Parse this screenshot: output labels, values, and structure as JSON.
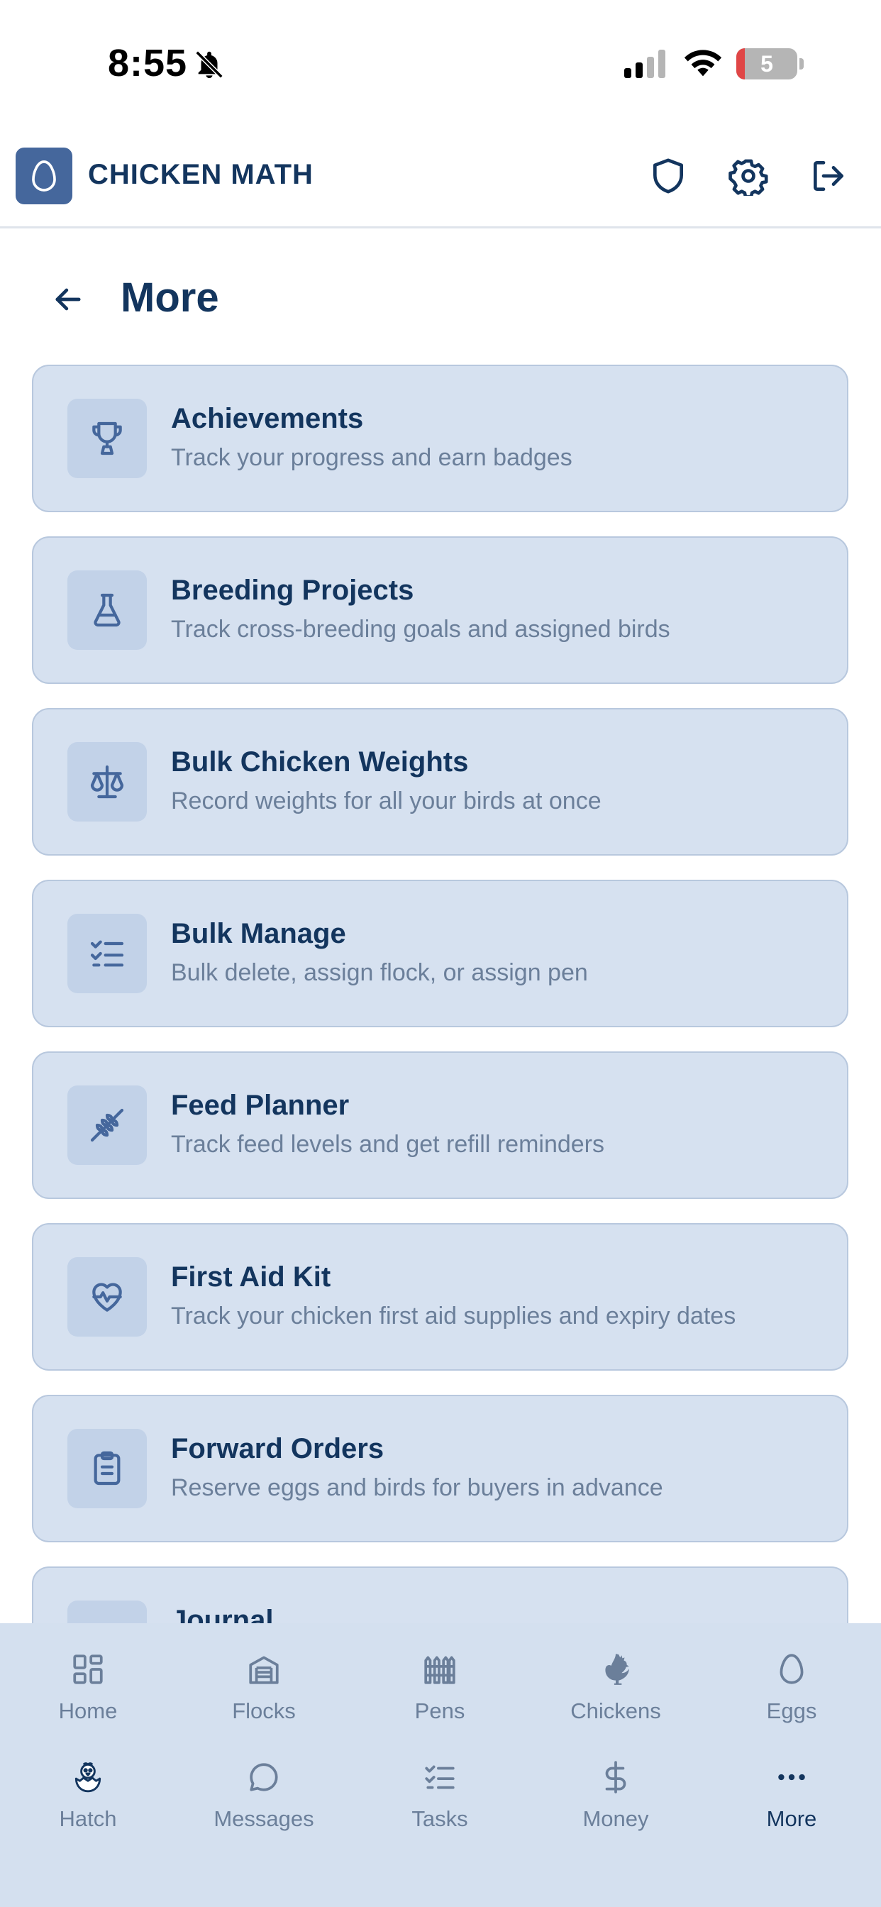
{
  "status_bar": {
    "time": "8:55",
    "battery": "5",
    "icons": [
      "bell-slash-icon",
      "signal-icon",
      "wifi-icon",
      "battery-icon"
    ]
  },
  "header": {
    "app_title": "CHICKEN MATH",
    "logo_icon": "egg-icon",
    "actions": [
      "shield-icon",
      "gear-icon",
      "logout-icon"
    ]
  },
  "page": {
    "title": "More",
    "back_icon": "arrow-left-icon"
  },
  "menu": [
    {
      "title": "Achievements",
      "subtitle": "Track your progress and earn badges",
      "icon": "trophy-icon"
    },
    {
      "title": "Breeding Projects",
      "subtitle": "Track cross-breeding goals and assigned birds",
      "icon": "flask-icon"
    },
    {
      "title": "Bulk Chicken Weights",
      "subtitle": "Record weights for all your birds at once",
      "icon": "scale-icon"
    },
    {
      "title": "Bulk Manage",
      "subtitle": "Bulk delete, assign flock, or assign pen",
      "icon": "checklist-icon"
    },
    {
      "title": "Feed Planner",
      "subtitle": "Track feed levels and get refill reminders",
      "icon": "wheat-icon"
    },
    {
      "title": "First Aid Kit",
      "subtitle": "Track your chicken first aid supplies and expiry dates",
      "icon": "heart-pulse-icon"
    },
    {
      "title": "Forward Orders",
      "subtitle": "Reserve eggs and birds for buyers in advance",
      "icon": "clipboard-icon"
    },
    {
      "title": "Journal",
      "subtitle": "",
      "icon": "book-icon"
    }
  ],
  "bottom_nav": [
    {
      "label": "Home",
      "icon": "dashboard-icon"
    },
    {
      "label": "Flocks",
      "icon": "barn-icon"
    },
    {
      "label": "Pens",
      "icon": "fence-icon"
    },
    {
      "label": "Chickens",
      "icon": "rooster-icon"
    },
    {
      "label": "Eggs",
      "icon": "egg-icon"
    },
    {
      "label": "Hatch",
      "icon": "hatching-chick-icon"
    },
    {
      "label": "Messages",
      "icon": "chat-bubble-icon"
    },
    {
      "label": "Tasks",
      "icon": "checklist-icon"
    },
    {
      "label": "Money",
      "icon": "dollar-icon"
    },
    {
      "label": "More",
      "icon": "ellipsis-icon",
      "active": true
    }
  ],
  "colors": {
    "primary": "#13355e",
    "card_bg": "#d6e1f0",
    "card_border": "#b8c8de",
    "icon_bg": "#c2d2e8",
    "subtitle": "#6b7f9a",
    "logo_bg": "#45679c",
    "nav_bg": "#d4e0ef"
  }
}
